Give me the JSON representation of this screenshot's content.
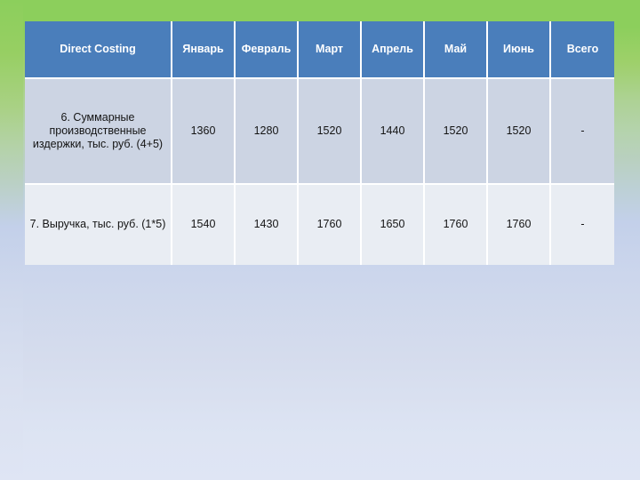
{
  "slide": {
    "background_top_color": "#8ccf5c",
    "background_bottom_color": "#dfe5f4"
  },
  "table": {
    "header_background": "#4a7ebb",
    "header_text_color": "#ffffff",
    "row_odd_background": "#ccd4e3",
    "row_even_background": "#e9edf3",
    "columns": [
      "Direct Costing",
      "Январь",
      "Февраль",
      "Март",
      "Апрель",
      "Май",
      "Июнь",
      "Всего"
    ],
    "rows": [
      {
        "label": "6. Суммарные производственные издержки, тыс. руб. (4+5)",
        "values": [
          "1360",
          "1280",
          "1520",
          "1440",
          "1520",
          "1520",
          "-"
        ]
      },
      {
        "label": "7. Выручка, тыс. руб. (1*5)",
        "values": [
          "1540",
          "1430",
          "1760",
          "1650",
          "1760",
          "1760",
          "-"
        ]
      }
    ]
  }
}
